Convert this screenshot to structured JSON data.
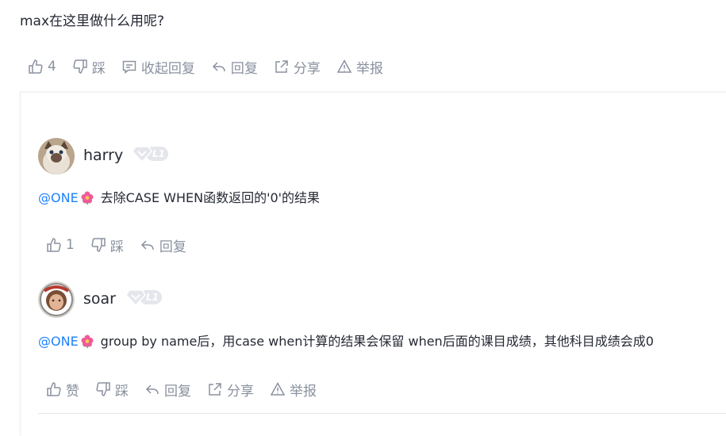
{
  "question": "max在这里做什么用呢?",
  "main_actions": {
    "like_count": "4",
    "dislike": "踩",
    "collapse_replies": "收起回复",
    "reply": "回复",
    "share": "分享",
    "report": "举报"
  },
  "replies": [
    {
      "username": "harry",
      "level": "L1",
      "mention": "@ONE",
      "text": "去除CASE WHEN函数返回的'0'的结果",
      "like_count": "1",
      "dislike": "踩",
      "reply": "回复"
    },
    {
      "username": "soar",
      "level": "L1",
      "mention": "@ONE",
      "text": "group by name后，用case when计算的结果会保留 when后面的课目成绩，其他科目成绩会成0",
      "like": "赞",
      "dislike": "踩",
      "reply": "回复",
      "share": "分享",
      "report": "举报"
    }
  ],
  "colors": {
    "text_primary": "#252933",
    "text_secondary": "#8a919f",
    "mention": "#1e80ff",
    "badge": "#e4e6eb"
  }
}
